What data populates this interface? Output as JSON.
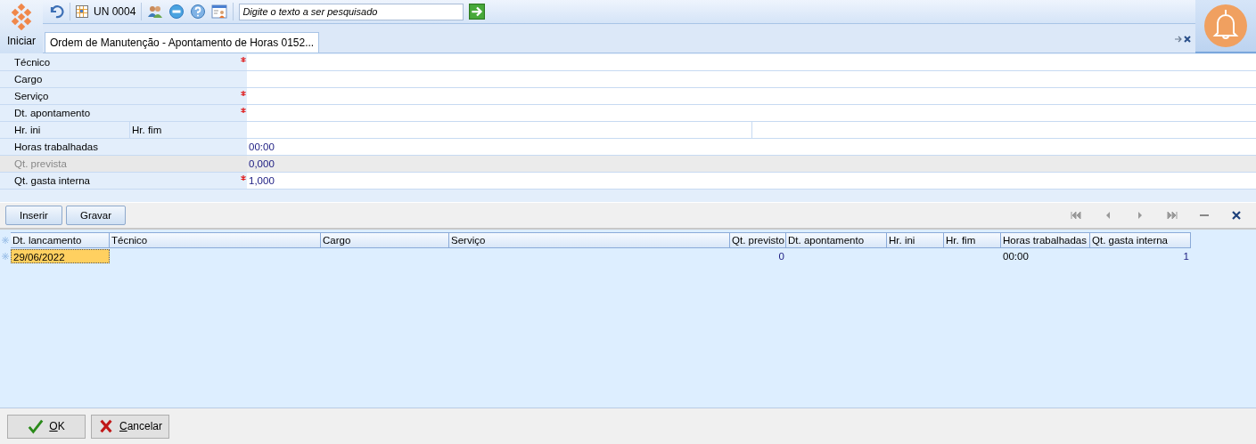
{
  "toolbar": {
    "start_label": "Iniciar",
    "unit": "UN 0004",
    "search": {
      "placeholder": "Digite o texto a ser pesquisado"
    }
  },
  "tabs": [
    {
      "label": "Ordem de Manutenção - Apontamento de Horas 0152...",
      "selected": true
    }
  ],
  "form": [
    {
      "kind": "single",
      "label": "Técnico",
      "required": true,
      "disabled": false
    },
    {
      "kind": "single",
      "label": "Cargo",
      "required": false,
      "disabled": false
    },
    {
      "kind": "single",
      "label": "Serviço",
      "required": true,
      "disabled": false
    },
    {
      "kind": "single",
      "label": "Dt. apontamento",
      "required": true,
      "disabled": false
    },
    {
      "kind": "pair",
      "label": "Hr. ini",
      "label_2": "Hr. fim",
      "required": false,
      "disabled": false
    },
    {
      "kind": "single",
      "label": "Horas trabalhadas",
      "value": "00:00",
      "required": false,
      "disabled": false
    },
    {
      "kind": "single",
      "label": "Qt. prevista",
      "value": "0,000",
      "required": false,
      "disabled": true
    },
    {
      "kind": "single",
      "label": "Qt. gasta interna",
      "value": "1,000",
      "required": true,
      "disabled": false
    }
  ],
  "grid_buttons": [
    "Inserir",
    "Gravar"
  ],
  "table": {
    "columns": [
      "Dt. lancamento",
      "Técnico",
      "Cargo",
      "Serviço",
      "Qt. previsto",
      "Dt. apontamento",
      "Hr. ini",
      "Hr. fim",
      "Horas trabalhadas",
      "Qt. gasta interna"
    ],
    "rows": [
      {
        "selected": true,
        "cells": [
          "29/06/2022",
          null,
          null,
          null,
          "0",
          null,
          null,
          null,
          "00:00",
          "1"
        ]
      }
    ]
  },
  "footer_buttons": [
    {
      "kind": "ok",
      "label": "OK"
    },
    {
      "kind": "cancel",
      "label": "Cancelar"
    }
  ]
}
